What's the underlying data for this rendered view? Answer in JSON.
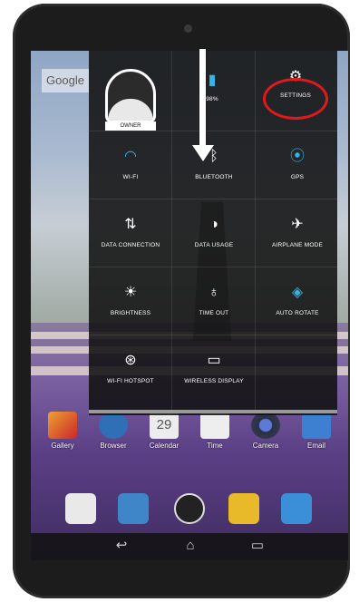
{
  "launcher": {
    "search_label": "Google"
  },
  "quick_settings": {
    "owner_label": "OWNER",
    "battery_label": "98%",
    "settings_label": "SETTINGS",
    "wifi_label": "WI-FI",
    "bluetooth_label": "BLUETOOTH",
    "gps_label": "GPS",
    "data_connection_label": "DATA CONNECTION",
    "data_usage_label": "DATA USAGE",
    "airplane_label": "AIRPLANE MODE",
    "brightness_label": "BRIGHTNESS",
    "timeout_label": "TIME OUT",
    "autorotate_label": "AUTO ROTATE",
    "hotspot_label": "WI-FI HOTSPOT",
    "wireless_display_label": "WIRELESS DISPLAY"
  },
  "home_apps": [
    {
      "label": "Gallery",
      "icon": "gallery-icon",
      "color": "#d9442a"
    },
    {
      "label": "Browser",
      "icon": "globe-icon",
      "color": "#2f6fb5"
    },
    {
      "label": "Calendar",
      "icon": "calendar-icon",
      "color": "#e8e8e8",
      "badge": "29"
    },
    {
      "label": "Time",
      "icon": "clock-icon",
      "color": "#eeeeee"
    },
    {
      "label": "Camera",
      "icon": "camera-icon",
      "color": "#3a3f55"
    },
    {
      "label": "Email",
      "icon": "email-icon",
      "color": "#3d7fd0"
    }
  ],
  "dock": [
    "play-store-icon",
    "contacts-icon",
    "apps-drawer-icon",
    "messaging-icon",
    "settings-gear-icon"
  ],
  "navbar": [
    "back-icon",
    "home-icon",
    "recents-icon"
  ],
  "colors": {
    "accent": "#33b5e5",
    "annotation": "#e01a1a"
  }
}
